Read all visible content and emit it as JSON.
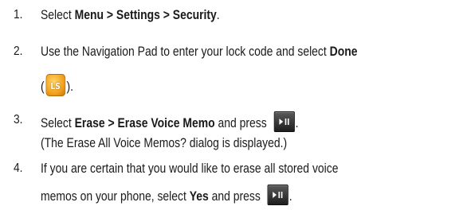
{
  "steps": [
    {
      "number": "1.",
      "lines": [
        {
          "t1": "Select ",
          "b1": "Menu > Settings > Security",
          "t2": "."
        }
      ]
    },
    {
      "number": "2.",
      "lines": [
        {
          "t1": "Use the Navigation Pad to enter your lock code and select ",
          "b1": "Done"
        },
        {
          "t1": "(",
          "key_label": "LS",
          "t2": ")."
        }
      ]
    },
    {
      "number": "3.",
      "lines": [
        {
          "t1": "Select ",
          "b1": "Erase > Erase Voice Memo",
          "t2": " and press ",
          "t3": "."
        },
        {
          "t1": "(The Erase All Voice Memos? dialog is displayed.)"
        }
      ]
    },
    {
      "number": "4.",
      "lines": [
        {
          "t1": "If you are certain that you would like to erase all stored voice"
        },
        {
          "t1": "memos on your phone, select ",
          "b1": "Yes",
          "t2": " and press ",
          "t3": "."
        }
      ]
    }
  ],
  "icons": {
    "soft_key": "left-soft-key-icon",
    "play_pause": "play-pause-key-icon"
  },
  "colors": {
    "text": "#1a1a1a",
    "soft_key": "#f2a21c",
    "key_button": "#2a2a2a"
  }
}
